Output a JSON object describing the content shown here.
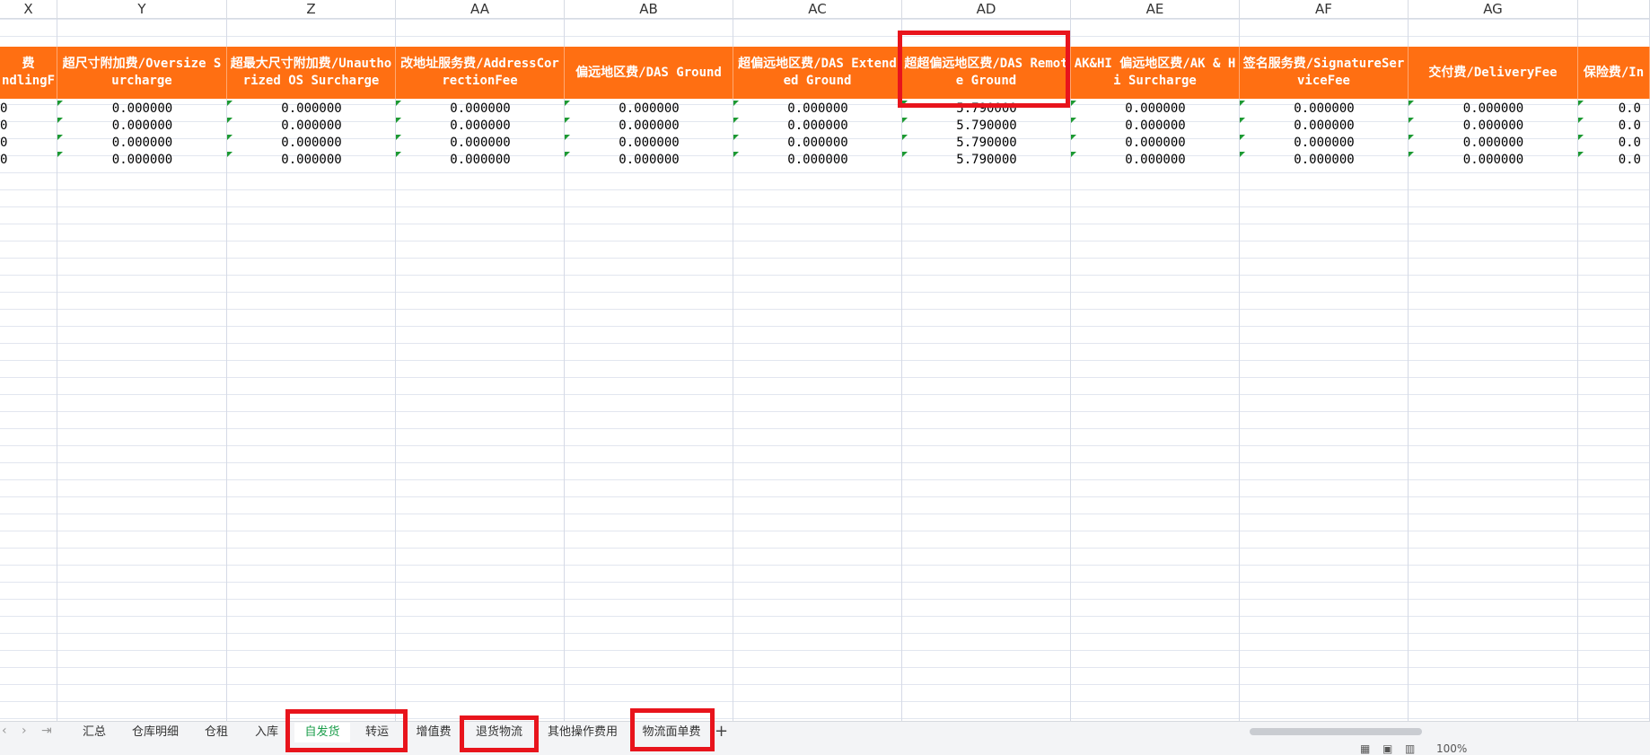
{
  "columns": [
    {
      "letter": "X",
      "header": "费\nndlingF",
      "values": [
        "0",
        "0",
        "0",
        "0"
      ]
    },
    {
      "letter": "Y",
      "header": "超尺寸附加费/Oversize Surcharge",
      "values": [
        "0.000000",
        "0.000000",
        "0.000000",
        "0.000000"
      ]
    },
    {
      "letter": "Z",
      "header": "超最大尺寸附加费/Unauthorized OS Surcharge",
      "values": [
        "0.000000",
        "0.000000",
        "0.000000",
        "0.000000"
      ]
    },
    {
      "letter": "AA",
      "header": "改地址服务费/AddressCorrectionFee",
      "values": [
        "0.000000",
        "0.000000",
        "0.000000",
        "0.000000"
      ]
    },
    {
      "letter": "AB",
      "header": "偏远地区费/DAS Ground",
      "values": [
        "0.000000",
        "0.000000",
        "0.000000",
        "0.000000"
      ]
    },
    {
      "letter": "AC",
      "header": "超偏远地区费/DAS Extended Ground",
      "values": [
        "0.000000",
        "0.000000",
        "0.000000",
        "0.000000"
      ]
    },
    {
      "letter": "AD",
      "header": "超超偏远地区费/DAS Remote Ground",
      "values": [
        "5.790000",
        "5.790000",
        "5.790000",
        "5.790000"
      ]
    },
    {
      "letter": "AE",
      "header": "AK&HI 偏远地区费/AK & Hi Surcharge",
      "values": [
        "0.000000",
        "0.000000",
        "0.000000",
        "0.000000"
      ]
    },
    {
      "letter": "AF",
      "header": "签名服务费/SignatureServiceFee",
      "values": [
        "0.000000",
        "0.000000",
        "0.000000",
        "0.000000"
      ]
    },
    {
      "letter": "AG",
      "header": "交付费/DeliveryFee",
      "values": [
        "0.000000",
        "0.000000",
        "0.000000",
        "0.000000"
      ]
    },
    {
      "letter": "",
      "header": "保险费/In",
      "values": [
        "0.0",
        "0.0",
        "0.0",
        "0.0"
      ]
    }
  ],
  "sheet_tabs": [
    "汇总",
    "仓库明细",
    "仓租",
    "入库",
    "自发货",
    "转运",
    "增值费",
    "退货物流",
    "其他操作费用",
    "物流面单费"
  ],
  "active_tab": "自发货",
  "nav_icons": [
    "prev-sheet-icon",
    "next-sheet-icon",
    "last-sheet-icon"
  ],
  "add_sheet_icon": "plus-icon",
  "status_bar": {
    "zoom": "100%"
  },
  "colors": {
    "header_bg": "#ff6f12",
    "highlight": "#e8141c",
    "active_tab": "#1a9d4a"
  }
}
